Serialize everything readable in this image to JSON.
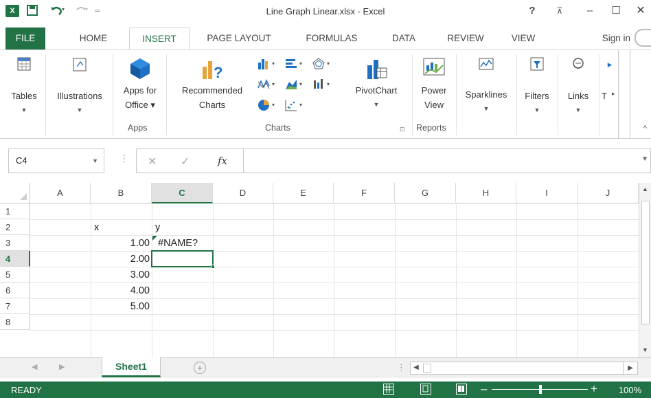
{
  "window": {
    "title": "Line Graph Linear.xlsx - Excel",
    "help": "?",
    "restore_ribbon": "⊼",
    "minimize": "–",
    "maximize": "☐",
    "close": "✕"
  },
  "quick_access": {
    "save_icon": "save-icon",
    "undo_icon": "undo-icon",
    "redo_icon": "redo-icon"
  },
  "tabs": [
    {
      "label": "FILE"
    },
    {
      "label": "HOME"
    },
    {
      "label": "INSERT"
    },
    {
      "label": "PAGE LAYOUT"
    },
    {
      "label": "FORMULAS"
    },
    {
      "label": "DATA"
    },
    {
      "label": "REVIEW"
    },
    {
      "label": "VIEW"
    }
  ],
  "active_tab": "INSERT",
  "sign_in": "Sign in",
  "ribbon": {
    "tables": "Tables",
    "illustrations": "Illustrations",
    "apps_for_office_1": "Apps for",
    "apps_for_office_2": "Office ▾",
    "recommended_charts_1": "Recommended",
    "recommended_charts_2": "Charts",
    "pivotchart": "PivotChart",
    "power_view_1": "Power",
    "power_view_2": "View",
    "sparklines": "Sparklines",
    "filters": "Filters",
    "links": "Links",
    "text_truncated": "T",
    "groups": {
      "apps": "Apps",
      "charts": "Charts",
      "reports": "Reports"
    }
  },
  "formula_bar": {
    "name_box": "C4",
    "cancel": "✕",
    "enter": "✓",
    "fx": "fx",
    "content": ""
  },
  "columns": [
    "A",
    "B",
    "C",
    "D",
    "E",
    "F",
    "G",
    "H",
    "I",
    "J"
  ],
  "selected_column": "C",
  "rows": [
    "1",
    "2",
    "3",
    "4",
    "5",
    "6",
    "7",
    "8"
  ],
  "selected_row": "4",
  "cells": {
    "B2": "x",
    "C2": "y",
    "B3": "1.00",
    "C3": "#NAME?",
    "B4": "2.00",
    "B5": "3.00",
    "B6": "4.00",
    "B7": "5.00"
  },
  "sheets": [
    {
      "name": "Sheet1"
    }
  ],
  "add_sheet": "+",
  "status": {
    "ready": "READY",
    "zoom": "100%",
    "zoom_minus": "–",
    "zoom_plus": "+"
  }
}
